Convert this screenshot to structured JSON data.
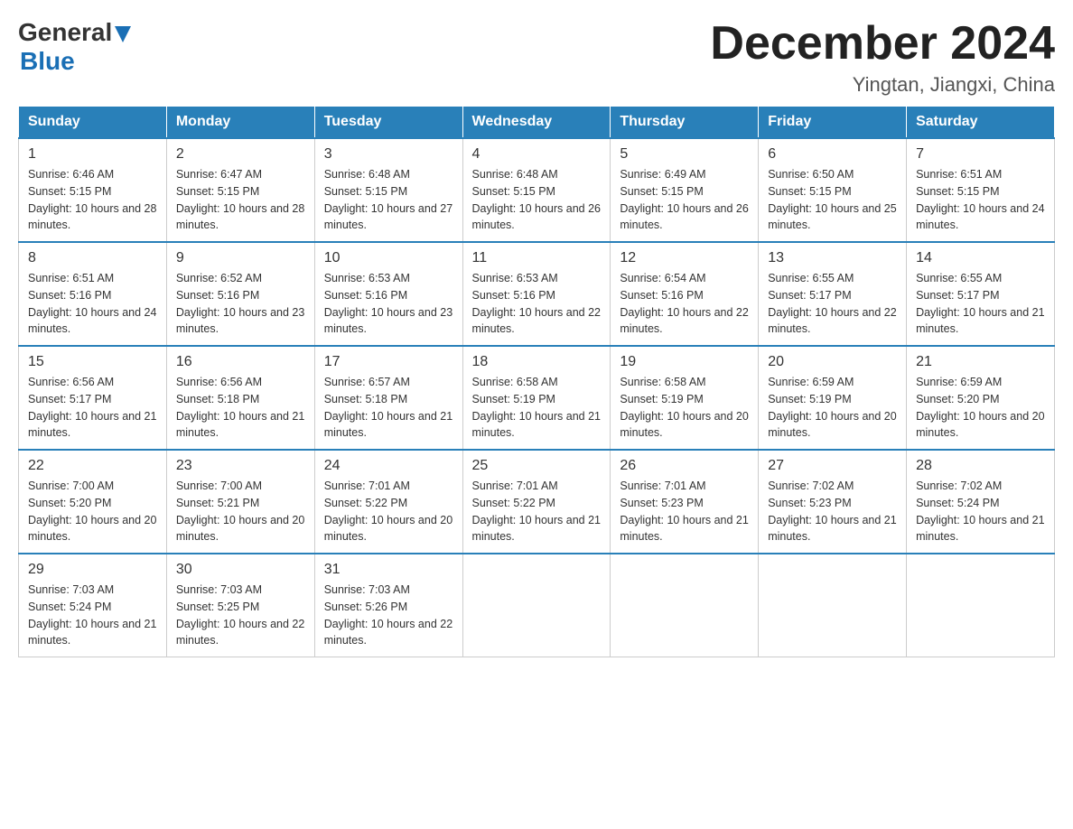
{
  "header": {
    "logo_general": "General",
    "logo_blue": "Blue",
    "month_title": "December 2024",
    "location": "Yingtan, Jiangxi, China"
  },
  "weekdays": [
    "Sunday",
    "Monday",
    "Tuesday",
    "Wednesday",
    "Thursday",
    "Friday",
    "Saturday"
  ],
  "weeks": [
    [
      {
        "day": "1",
        "sunrise": "6:46 AM",
        "sunset": "5:15 PM",
        "daylight": "10 hours and 28 minutes."
      },
      {
        "day": "2",
        "sunrise": "6:47 AM",
        "sunset": "5:15 PM",
        "daylight": "10 hours and 28 minutes."
      },
      {
        "day": "3",
        "sunrise": "6:48 AM",
        "sunset": "5:15 PM",
        "daylight": "10 hours and 27 minutes."
      },
      {
        "day": "4",
        "sunrise": "6:48 AM",
        "sunset": "5:15 PM",
        "daylight": "10 hours and 26 minutes."
      },
      {
        "day": "5",
        "sunrise": "6:49 AM",
        "sunset": "5:15 PM",
        "daylight": "10 hours and 26 minutes."
      },
      {
        "day": "6",
        "sunrise": "6:50 AM",
        "sunset": "5:15 PM",
        "daylight": "10 hours and 25 minutes."
      },
      {
        "day": "7",
        "sunrise": "6:51 AM",
        "sunset": "5:15 PM",
        "daylight": "10 hours and 24 minutes."
      }
    ],
    [
      {
        "day": "8",
        "sunrise": "6:51 AM",
        "sunset": "5:16 PM",
        "daylight": "10 hours and 24 minutes."
      },
      {
        "day": "9",
        "sunrise": "6:52 AM",
        "sunset": "5:16 PM",
        "daylight": "10 hours and 23 minutes."
      },
      {
        "day": "10",
        "sunrise": "6:53 AM",
        "sunset": "5:16 PM",
        "daylight": "10 hours and 23 minutes."
      },
      {
        "day": "11",
        "sunrise": "6:53 AM",
        "sunset": "5:16 PM",
        "daylight": "10 hours and 22 minutes."
      },
      {
        "day": "12",
        "sunrise": "6:54 AM",
        "sunset": "5:16 PM",
        "daylight": "10 hours and 22 minutes."
      },
      {
        "day": "13",
        "sunrise": "6:55 AM",
        "sunset": "5:17 PM",
        "daylight": "10 hours and 22 minutes."
      },
      {
        "day": "14",
        "sunrise": "6:55 AM",
        "sunset": "5:17 PM",
        "daylight": "10 hours and 21 minutes."
      }
    ],
    [
      {
        "day": "15",
        "sunrise": "6:56 AM",
        "sunset": "5:17 PM",
        "daylight": "10 hours and 21 minutes."
      },
      {
        "day": "16",
        "sunrise": "6:56 AM",
        "sunset": "5:18 PM",
        "daylight": "10 hours and 21 minutes."
      },
      {
        "day": "17",
        "sunrise": "6:57 AM",
        "sunset": "5:18 PM",
        "daylight": "10 hours and 21 minutes."
      },
      {
        "day": "18",
        "sunrise": "6:58 AM",
        "sunset": "5:19 PM",
        "daylight": "10 hours and 21 minutes."
      },
      {
        "day": "19",
        "sunrise": "6:58 AM",
        "sunset": "5:19 PM",
        "daylight": "10 hours and 20 minutes."
      },
      {
        "day": "20",
        "sunrise": "6:59 AM",
        "sunset": "5:19 PM",
        "daylight": "10 hours and 20 minutes."
      },
      {
        "day": "21",
        "sunrise": "6:59 AM",
        "sunset": "5:20 PM",
        "daylight": "10 hours and 20 minutes."
      }
    ],
    [
      {
        "day": "22",
        "sunrise": "7:00 AM",
        "sunset": "5:20 PM",
        "daylight": "10 hours and 20 minutes."
      },
      {
        "day": "23",
        "sunrise": "7:00 AM",
        "sunset": "5:21 PM",
        "daylight": "10 hours and 20 minutes."
      },
      {
        "day": "24",
        "sunrise": "7:01 AM",
        "sunset": "5:22 PM",
        "daylight": "10 hours and 20 minutes."
      },
      {
        "day": "25",
        "sunrise": "7:01 AM",
        "sunset": "5:22 PM",
        "daylight": "10 hours and 21 minutes."
      },
      {
        "day": "26",
        "sunrise": "7:01 AM",
        "sunset": "5:23 PM",
        "daylight": "10 hours and 21 minutes."
      },
      {
        "day": "27",
        "sunrise": "7:02 AM",
        "sunset": "5:23 PM",
        "daylight": "10 hours and 21 minutes."
      },
      {
        "day": "28",
        "sunrise": "7:02 AM",
        "sunset": "5:24 PM",
        "daylight": "10 hours and 21 minutes."
      }
    ],
    [
      {
        "day": "29",
        "sunrise": "7:03 AM",
        "sunset": "5:24 PM",
        "daylight": "10 hours and 21 minutes."
      },
      {
        "day": "30",
        "sunrise": "7:03 AM",
        "sunset": "5:25 PM",
        "daylight": "10 hours and 22 minutes."
      },
      {
        "day": "31",
        "sunrise": "7:03 AM",
        "sunset": "5:26 PM",
        "daylight": "10 hours and 22 minutes."
      },
      null,
      null,
      null,
      null
    ]
  ]
}
